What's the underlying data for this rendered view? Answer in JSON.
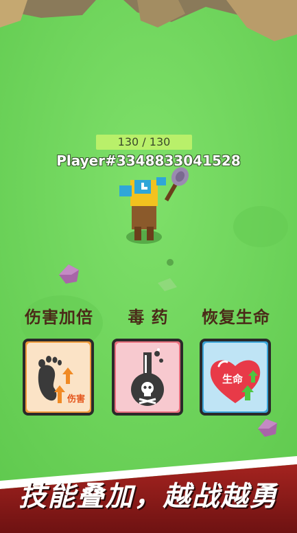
{
  "hud": {
    "hp_text": "130 / 130",
    "hp_fraction": 1.0,
    "player_name": "Player#3348833041528"
  },
  "skills": [
    {
      "label": "伤害加倍",
      "icon": "footprint-damage-up-icon",
      "icon_text": "伤害",
      "bg": "#fbe3c6"
    },
    {
      "label": "毒 药",
      "icon": "poison-flask-skull-icon",
      "icon_text": "",
      "bg": "#f7c9cf"
    },
    {
      "label": "恢复生命",
      "icon": "heart-life-up-icon",
      "icon_text": "生命",
      "bg": "#bfe4f5"
    }
  ],
  "banner": {
    "text": "技能叠加，越战越勇"
  },
  "colors": {
    "grass": "#6fd65c",
    "banner_red": "#8e1a1a",
    "card_border": "#2a2a2a",
    "label": "#4a2a18"
  }
}
